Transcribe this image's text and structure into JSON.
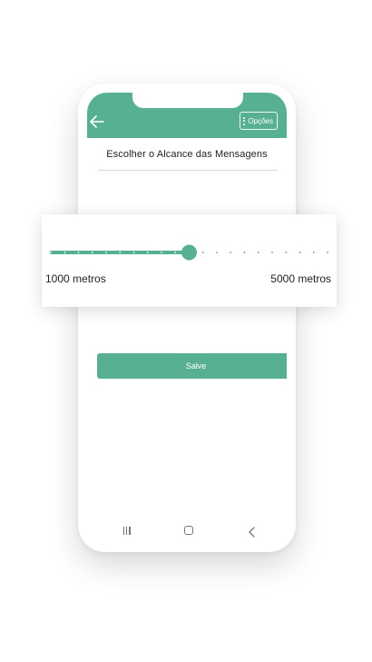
{
  "app": {
    "header": {
      "options_label": "Opções",
      "icon_back": "arrow-left-icon",
      "icon_options": "more-vertical-icon"
    },
    "title": "Escolher o Alcance das Mensagens",
    "slider": {
      "min_label": "1000 metros",
      "max_label": "5000 metros",
      "min": 1000,
      "max": 5000,
      "value": 3000,
      "divisions": 20
    },
    "save_label": "Salve",
    "navbar": {
      "icons": [
        "recents-icon",
        "home-icon",
        "back-icon"
      ]
    }
  },
  "colors": {
    "accent": "#58b092",
    "text": "#222222",
    "tick": "#8a8a8a"
  }
}
